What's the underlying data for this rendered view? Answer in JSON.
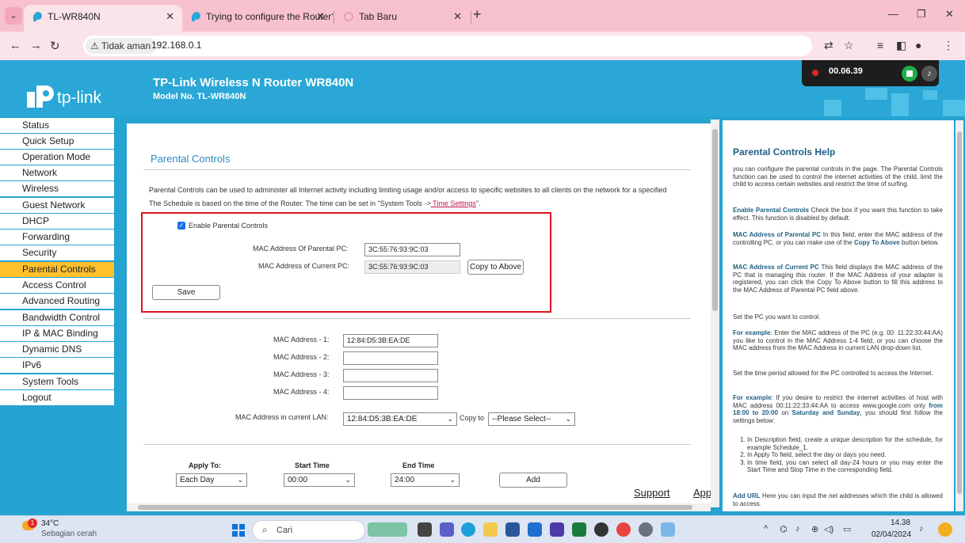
{
  "browser": {
    "tabs": [
      {
        "title": "TL-WR840N"
      },
      {
        "title": "Trying to configure the Router?"
      },
      {
        "title": "Tab Baru"
      }
    ],
    "security_label": "Tidak aman",
    "url": "192.168.0.1"
  },
  "recorder": {
    "time": "00.06.39"
  },
  "router": {
    "logo_text": "tp-link",
    "title": "TP-Link Wireless N Router WR840N",
    "model": "Model No. TL-WR840N"
  },
  "menu": {
    "items": [
      {
        "label": "Status"
      },
      {
        "label": "Quick Setup"
      },
      {
        "label": "Operation Mode"
      },
      {
        "label": "Network"
      },
      {
        "label": "Wireless"
      },
      {
        "label": "Guest Network"
      },
      {
        "label": "DHCP"
      },
      {
        "label": "Forwarding"
      },
      {
        "label": "Security"
      },
      {
        "label": "Parental Controls"
      },
      {
        "label": "Access Control"
      },
      {
        "label": "Advanced Routing"
      },
      {
        "label": "Bandwidth Control"
      },
      {
        "label": "IP & MAC Binding"
      },
      {
        "label": "Dynamic DNS"
      },
      {
        "label": "IPv6"
      },
      {
        "label": "System Tools"
      },
      {
        "label": "Logout"
      }
    ],
    "active_index": 9
  },
  "page": {
    "title": "Parental Controls",
    "desc_line1": "Parental Controls can be used to administer all Internet activity including limiting usage and/or access to specific websites to all clients on the network for a specified",
    "desc_line2": "The Schedule is based on the time of the Router. The time can be set in \"System Tools ->",
    "desc_link": " Time Settings",
    "desc_end": "\".",
    "enable_label": "Enable Parental Controls",
    "enable_checked": true,
    "mac_parental_label": "MAC Address Of Parental PC:",
    "mac_parental_value": "3C:55:76:93:9C:03",
    "mac_current_label": "MAC Address of Current PC:",
    "mac_current_value": "3C:55:76:93:9C:03",
    "copy_above_label": "Copy to Above",
    "save_label": "Save",
    "mac_fields": [
      {
        "label": "MAC Address - 1:",
        "value": "12:84:D5:3B:EA:DE"
      },
      {
        "label": "MAC Address - 2:",
        "value": ""
      },
      {
        "label": "MAC Address - 3:",
        "value": ""
      },
      {
        "label": "MAC Address - 4:",
        "value": ""
      }
    ],
    "lan_label": "MAC Address in current LAN:",
    "lan_value": "12:84:D5:3B:EA:DE",
    "copy_to_label": "Copy to",
    "copy_to_value": "--Please Select--",
    "apply_to_label": "Apply To:",
    "apply_to_value": "Each Day",
    "start_time_label": "Start Time",
    "start_time_value": "00:00",
    "end_time_label": "End Time",
    "end_time_value": "24:00",
    "add_label": "Add",
    "support_label": "Support",
    "app_label": "App"
  },
  "help": {
    "title": "Parental Controls Help",
    "p1": "you can configure the parental controls in the page. The Parental Controls function can be used to control the internet activities of the child, limit the child to access certain websites and restrict the time of surfing.",
    "p2_term": "Enable Parental Controls",
    "p2": " Check the box if you want this function to take effect. This function is disabled by default.",
    "p3_term": "MAC Address of Parental PC",
    "p3": " In this field, enter the MAC address of the controlling PC, or you can make use of the ",
    "p3_term2": "Copy To Above",
    "p3_end": " button below.",
    "p4_term": "MAC Address of Current PC",
    "p4": " This field displays the MAC address of the PC that is managing this router. If the MAC Address of your adapter is registered, you can click the Copy To Above button to fill this address to the MAC Address of Parental PC field above.",
    "p5": "Set the PC you want to control.",
    "p6_term": "For example",
    "p6": ": Enter the MAC address of the PC (e.g. 00: 11:22:33:44:AA) you like to control in the MAC Address 1-4 field, or you can choose the MAC address from the MAC Address in current LAN drop-down list.",
    "p7": "Set the time period allowed for the PC controlled to access the Internet.",
    "p8_term": "For example",
    "p8a": ": If you desire to restrict the internet activities of host with MAC address 00:11:22:33:44:AA to access www.google.com only ",
    "p8_b1": "from 18:00 to 20:00",
    "p8b": " on ",
    "p8_b2": "Saturday and Sunday",
    "p8c": ", you should first follow the settings below:",
    "list": [
      "In Description field, create a unique description for the schedule, for example Schedule_1.",
      "In Apply To field, select the day or days you need.",
      "In time field, you can select all day-24 hours or you may enter the Start Time and Stop Time in the corresponding field."
    ],
    "p9_term": "Add URL",
    "p9": " Here you can input the net addresses which the child is allowed to access."
  },
  "taskbar": {
    "weather_badge": "1",
    "weather_temp": "34°C",
    "weather_desc": "Sebagian cerah",
    "search_label": "Cari",
    "time": "14.38",
    "date": "02/04/2024"
  }
}
